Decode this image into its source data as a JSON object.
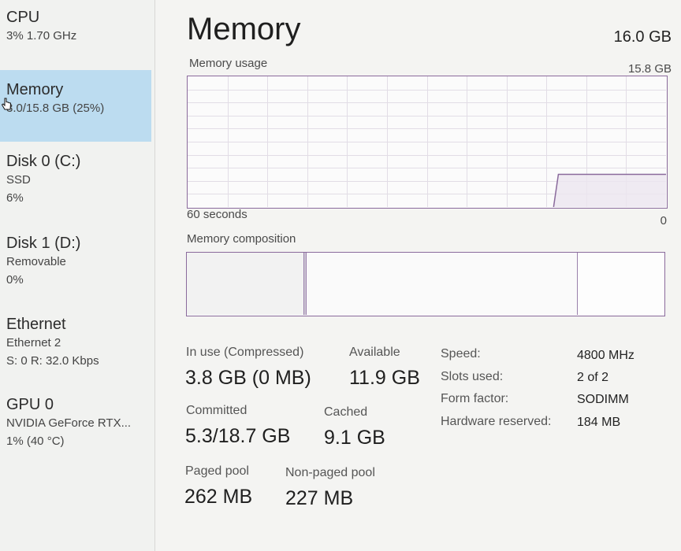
{
  "sidebar": {
    "items": [
      {
        "title": "CPU",
        "lines": [
          "3%  1.70 GHz"
        ]
      },
      {
        "title": "Memory",
        "lines": [
          "3.0/15.8 GB (25%)"
        ]
      },
      {
        "title": "Disk 0 (C:)",
        "lines": [
          "SSD",
          "6%"
        ]
      },
      {
        "title": "Disk 1 (D:)",
        "lines": [
          "Removable",
          "0%"
        ]
      },
      {
        "title": "Ethernet",
        "lines": [
          "Ethernet 2",
          "S: 0 R: 32.0 Kbps"
        ]
      },
      {
        "title": "GPU 0",
        "lines": [
          "NVIDIA GeForce RTX...",
          "1% (40 °C)"
        ]
      }
    ]
  },
  "header": {
    "title": "Memory",
    "total": "16.0 GB"
  },
  "usage_graph": {
    "label": "Memory usage",
    "max_label": "15.8 GB",
    "time_label": "60 seconds",
    "min_label": "0",
    "line_color": "#8a6a9c",
    "current_fraction": 0.25
  },
  "composition": {
    "label": "Memory composition"
  },
  "stats": {
    "in_use_label": "In use (Compressed)",
    "in_use_value": "3.8 GB (0 MB)",
    "available_label": "Available",
    "available_value": "11.9 GB",
    "committed_label": "Committed",
    "committed_value": "5.3/18.7 GB",
    "cached_label": "Cached",
    "cached_value": "9.1 GB",
    "paged_label": "Paged pool",
    "paged_value": "262 MB",
    "nonpaged_label": "Non-paged pool",
    "nonpaged_value": "227 MB"
  },
  "specs": [
    {
      "label": "Speed:",
      "value": "4800 MHz"
    },
    {
      "label": "Slots used:",
      "value": "2 of 2"
    },
    {
      "label": "Form factor:",
      "value": "SODIMM"
    },
    {
      "label": "Hardware reserved:",
      "value": "184 MB"
    }
  ]
}
